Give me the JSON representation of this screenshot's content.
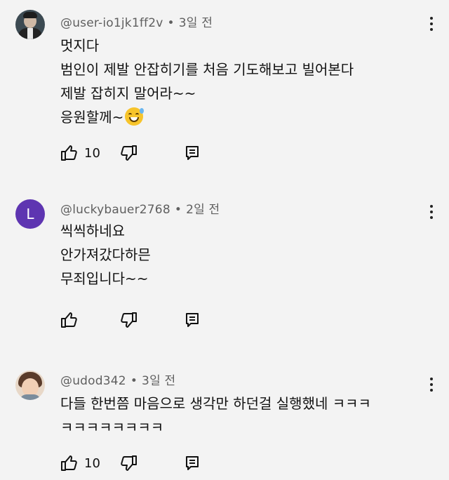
{
  "comments": [
    {
      "username": "@user-io1jk1ff2v",
      "time": "3일 전",
      "avatar_icon": "profile-photo",
      "lines": [
        "멋지다",
        "범인이 제발 안잡히기를 처음 기도해보고 빌어본다",
        "제발 잡히지 말어라~~",
        "응원할께~"
      ],
      "emoji": "grinning-sweat-emoji",
      "likes": "10"
    },
    {
      "username": "@luckybauer2768",
      "time": "2일 전",
      "avatar_letter": "L",
      "avatar_color": "#5e35b1",
      "lines": [
        "씩씩하네요",
        "안가져갔다하믄",
        "무죄입니다~~"
      ],
      "likes": ""
    },
    {
      "username": "@udod342",
      "time": "3일 전",
      "avatar_icon": "profile-photo",
      "lines": [
        "다들 한번쯤 마음으로 생각만 하던걸 실행했네 ㅋㅋㅋ",
        "ㅋㅋㅋㅋㅋㅋㅋㅋ"
      ],
      "likes": "10"
    }
  ],
  "separator": "•",
  "icons": {
    "like": "thumbs-up-icon",
    "dislike": "thumbs-down-icon",
    "reply": "reply-icon",
    "more": "more-vertical-icon"
  }
}
